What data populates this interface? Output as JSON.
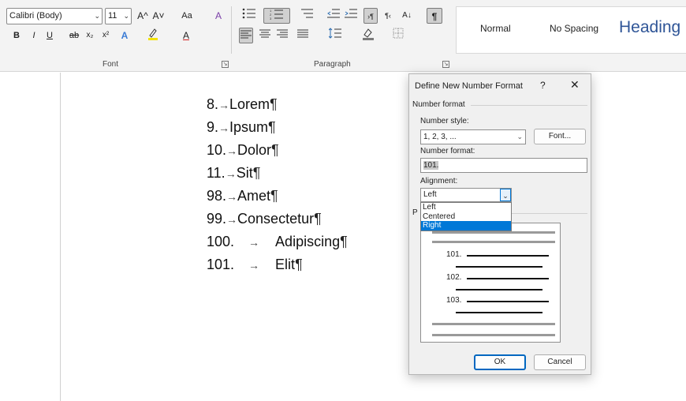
{
  "ribbon": {
    "font_name": "Calibri (Body)",
    "font_size": "11",
    "grow_font": "A^",
    "shrink_font": "A˅",
    "change_case": "Aa",
    "clear_format": "A",
    "bold": "B",
    "italic": "I",
    "underline": "U",
    "strikethrough": "ab",
    "subscript": "x₂",
    "superscript": "x²",
    "text_effects": "A",
    "font_color": "A",
    "font_group_label": "Font",
    "paragraph_group_label": "Paragraph",
    "show_marks": "¶",
    "sort": "A↓",
    "styles": [
      "Normal",
      "No Spacing",
      "Heading"
    ]
  },
  "document": {
    "lines": [
      {
        "num": "8.",
        "sep": "→",
        "text": "Lorem"
      },
      {
        "num": "9.",
        "sep": "→",
        "text": "Ipsum"
      },
      {
        "num": "10.",
        "sep": "→",
        "text": "Dolor"
      },
      {
        "num": "11.",
        "sep": "→",
        "text": "Sit"
      },
      {
        "num": "98.",
        "sep": "→",
        "text": "Amet"
      },
      {
        "num": "99.",
        "sep": "→",
        "text": "Consectetur"
      },
      {
        "num": "100.",
        "sep": "→",
        "text": "Adipiscing"
      },
      {
        "num": "101.",
        "sep": "→",
        "text": "Elit"
      }
    ],
    "pilcrow": "¶"
  },
  "dialog": {
    "title": "Define New Number Format",
    "help": "?",
    "close": "✕",
    "section_label": "Number format",
    "number_style_label": "Number style:",
    "number_style_value": "1, 2, 3, ...",
    "font_button": "Font...",
    "number_format_label": "Number format:",
    "number_format_value": "101.",
    "alignment_label": "Alignment:",
    "alignment_value": "Left",
    "alignment_options": [
      "Left",
      "Centered",
      "Right"
    ],
    "preview_label_fragment": "P",
    "preview_numbers": [
      "101.",
      "102.",
      "103."
    ],
    "ok_button": "OK",
    "cancel_button": "Cancel"
  },
  "colors": {
    "selection": "#0078d7",
    "ok_border": "#0067c0",
    "heading_style": "#2f5597"
  }
}
